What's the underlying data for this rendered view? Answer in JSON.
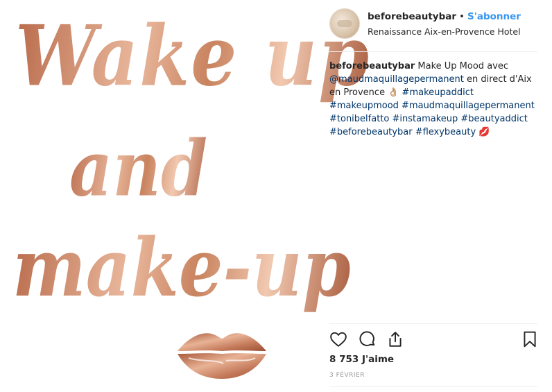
{
  "image": {
    "line1": "Wake up",
    "line2": "and",
    "line3": "make-up"
  },
  "header": {
    "username": "beforebeautybar",
    "separator": "•",
    "follow_label": "S'abonner",
    "location": "Renaissance Aix-en-Provence Hotel"
  },
  "caption": {
    "username": "beforebeautybar",
    "text1": "Make Up Mood avec",
    "mention": "@maudmaquillagepermanent",
    "text2": "en direct d'Aix en Provence",
    "emoji1": "👌🏼",
    "tag1": "#makeupaddict",
    "tag2": "#makeupmood",
    "tag3": "#maudmaquillagepermanent",
    "tag4": "#tonibelfatto",
    "tag5": "#instamakeup",
    "tag6": "#beautyaddict",
    "tag7": "#beforebeautybar",
    "tag8": "#flexybeauty",
    "emoji2": "💋"
  },
  "likes": "8 753 J'aime",
  "date": "3 FÉVRIER",
  "icons": [
    "heart-icon",
    "comment-icon",
    "share-icon",
    "bookmark-icon"
  ],
  "colors": {
    "follow": "#3897f0",
    "hashtag": "#003569",
    "rose_gold": "#c47a5a"
  }
}
